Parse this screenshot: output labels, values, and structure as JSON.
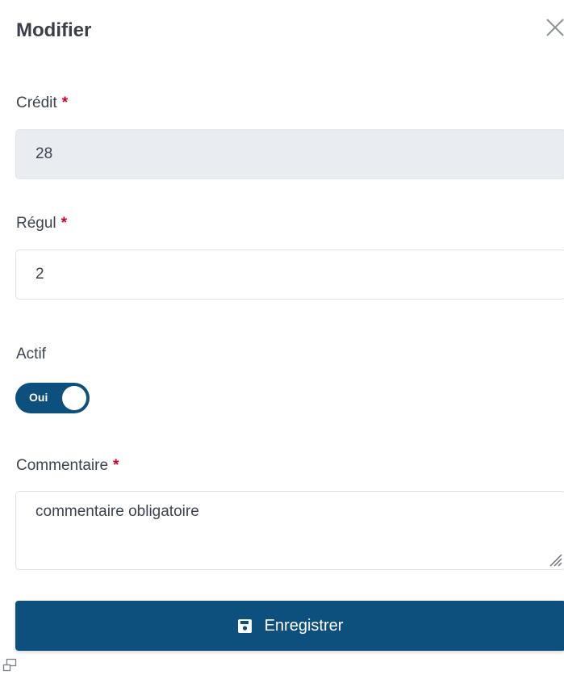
{
  "dialog": {
    "title": "Modifier",
    "close_icon": "close-icon"
  },
  "fields": {
    "credit": {
      "label": "Crédit",
      "required_mark": "*",
      "value": "28",
      "disabled": true
    },
    "regul": {
      "label": "Régul",
      "required_mark": "*",
      "value": "2"
    },
    "actif": {
      "label": "Actif",
      "toggle_text": "Oui",
      "checked": true
    },
    "commentaire": {
      "label": "Commentaire",
      "required_mark": "*",
      "value": "commentaire obligatoire"
    }
  },
  "actions": {
    "save_label": "Enregistrer",
    "save_icon": "floppy-disk-icon"
  },
  "colors": {
    "primary": "#0d4f7d",
    "required": "#d0021b",
    "disabled_bg": "#e9ecf0"
  }
}
